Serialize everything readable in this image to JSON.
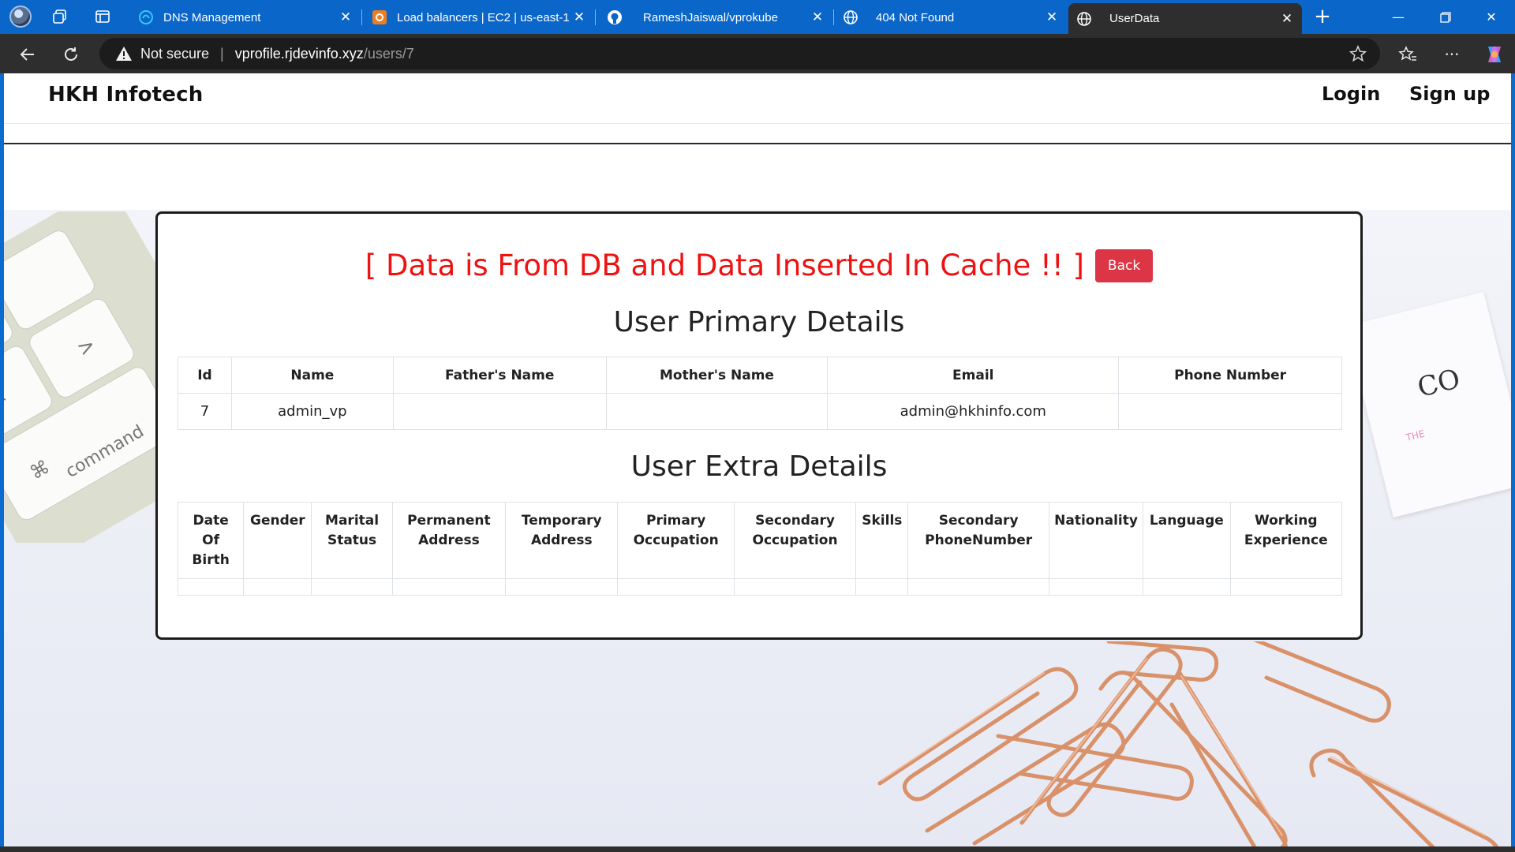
{
  "browser": {
    "tabs": [
      {
        "title": "DNS Management",
        "icon": "cloud-dns-icon"
      },
      {
        "title": "Load balancers | EC2 | us-east-1",
        "icon": "aws-icon"
      },
      {
        "title": "RameshJaiswal/vprokube",
        "icon": "github-icon"
      },
      {
        "title": "404 Not Found",
        "icon": "globe-icon"
      },
      {
        "title": "UserData",
        "icon": "globe-icon"
      }
    ],
    "address": {
      "security_label": "Not secure",
      "host": "vprofile.rjdevinfo.xyz",
      "path": "/users/7"
    }
  },
  "navbar": {
    "brand": "HKH Infotech",
    "login": "Login",
    "signup": "Sign up"
  },
  "content": {
    "cache_message": "[ Data is From DB and Data Inserted In Cache !! ]",
    "back_label": "Back",
    "primary_title": "User Primary Details",
    "primary_headers": [
      "Id",
      "Name",
      "Father's Name",
      "Mother's Name",
      "Email",
      "Phone Number"
    ],
    "primary_row": [
      "7",
      "admin_vp",
      "",
      "",
      "admin@hkhinfo.com",
      ""
    ],
    "extra_title": "User Extra Details",
    "extra_headers": [
      "Date Of Birth",
      "Gender",
      "Marital Status",
      "Permanent Address",
      "Temporary Address",
      "Primary Occupation",
      "Secondary Occupation",
      "Skills",
      "Secondary PhoneNumber",
      "Nationality",
      "Language",
      "Working Experience"
    ],
    "extra_row": [
      "",
      "",
      "",
      "",
      "",
      "",
      "",
      "",
      "",
      "",
      "",
      ""
    ]
  },
  "colors": {
    "tabstrip": "#0a66c8",
    "toolbar": "#2e2e2e",
    "cache_message": "#ee1212",
    "back_button": "#dc3545"
  }
}
